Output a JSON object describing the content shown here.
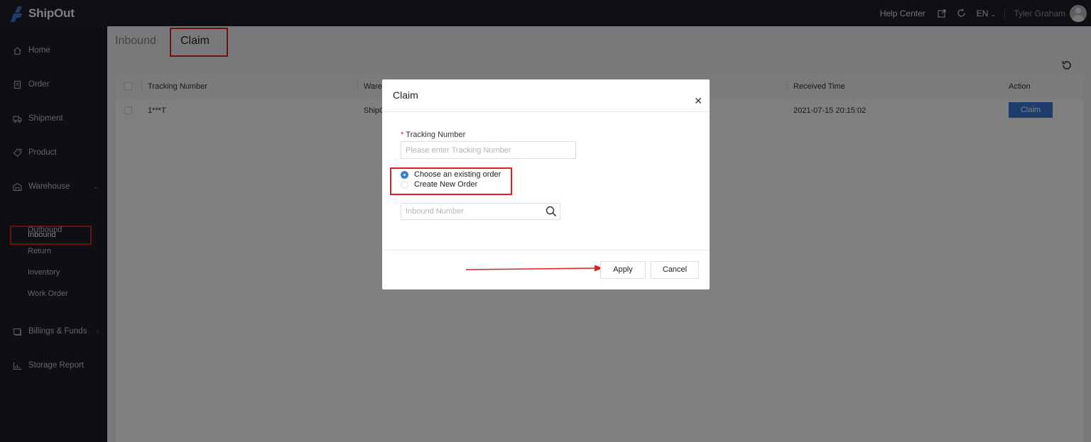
{
  "app": {
    "name": "ShipOut"
  },
  "topbar": {
    "help": "Help Center",
    "lang": "EN",
    "user": "Tyler Graham"
  },
  "sidebar": {
    "items": [
      {
        "label": "Home",
        "icon": "home-icon"
      },
      {
        "label": "Order",
        "icon": "order-icon"
      },
      {
        "label": "Shipment",
        "icon": "truck-icon"
      },
      {
        "label": "Product",
        "icon": "tag-icon"
      },
      {
        "label": "Warehouse",
        "icon": "warehouse-icon"
      },
      {
        "label": "Billings & Funds",
        "icon": "billing-icon"
      },
      {
        "label": "Storage Report",
        "icon": "chart-icon"
      }
    ],
    "warehouse_sub": [
      "Inbound",
      "Outbound",
      "Return",
      "Inventory",
      "Work Order"
    ]
  },
  "breadcrumb": {
    "parent": "Inbound",
    "current": "Claim"
  },
  "table": {
    "columns": [
      "Tracking Number",
      "Warel",
      "Received Time",
      "Action"
    ],
    "rows": [
      {
        "tracking": "1***T",
        "warehouse": "ShipC",
        "received": "2021-07-15 20:15:02",
        "action": "Claim"
      }
    ]
  },
  "modal": {
    "title": "Claim",
    "tracking_label": "Tracking Number",
    "tracking_placeholder": "Please enter Tracking Number",
    "option_existing": "Choose an existing order",
    "option_new": "Create New Order",
    "selected_option": "existing",
    "inbound_placeholder": "Inbound Number",
    "apply": "Apply",
    "cancel": "Cancel"
  },
  "colors": {
    "accent": "#3b7dd8",
    "highlight": "#e02020",
    "sidebar": "#1c1e25",
    "topbar": "#1f2129"
  }
}
